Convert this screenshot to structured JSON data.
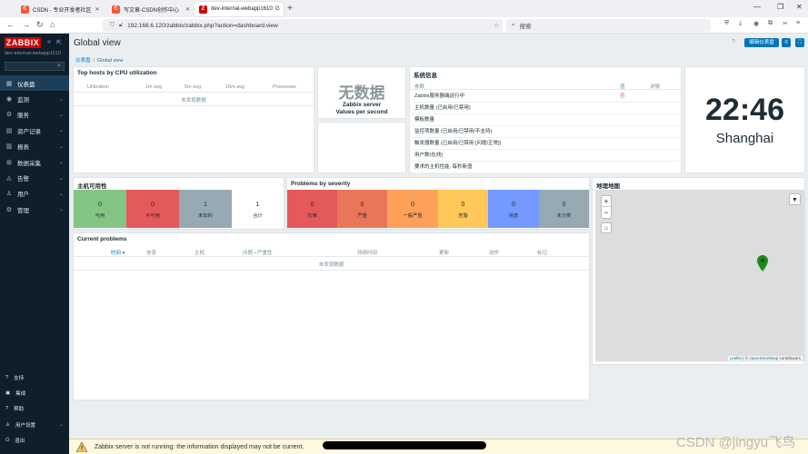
{
  "browser": {
    "tabs": [
      {
        "label": "CSDN - 专业开发者社区",
        "favicon": "C",
        "color": "#fc5531"
      },
      {
        "label": "写文章-CSDN创作中心",
        "favicon": "C",
        "color": "#fc5531"
      },
      {
        "label": "dev-internal-webapp1610: G",
        "favicon": "Z",
        "color": "#d40000"
      }
    ],
    "url": "192.168.6.120/zabbix/zabbix.php?action=dashboard.view",
    "search_placeholder": "搜索"
  },
  "sidebar": {
    "logo": "ZABBIX",
    "hostname": "dev-internal-webapp1610",
    "items": [
      {
        "label": "仪表盘",
        "icon": "dashboard-icon",
        "active": true
      },
      {
        "label": "监测",
        "icon": "eye-icon"
      },
      {
        "label": "服务",
        "icon": "services-icon"
      },
      {
        "label": "资产记录",
        "icon": "inventory-icon"
      },
      {
        "label": "报表",
        "icon": "reports-icon"
      },
      {
        "label": "数据采集",
        "icon": "data-collection-icon"
      },
      {
        "label": "告警",
        "icon": "bell-icon"
      },
      {
        "label": "用户",
        "icon": "users-icon"
      },
      {
        "label": "管理",
        "icon": "gear-icon"
      }
    ],
    "bottom_items": [
      {
        "label": "支持",
        "icon": "support-icon"
      },
      {
        "label": "集成",
        "icon": "integrations-icon"
      },
      {
        "label": "帮助",
        "icon": "help-icon"
      },
      {
        "label": "用户设置",
        "icon": "user-settings-icon"
      },
      {
        "label": "退出",
        "icon": "sign-out-icon"
      }
    ]
  },
  "header": {
    "title": "Global view",
    "edit_label": "编辑仪表盘",
    "breadcrumb": [
      "仪表盘",
      "Global view"
    ]
  },
  "top_hosts": {
    "title": "Top hosts by CPU utilization",
    "columns": [
      "Utilization",
      "1m avg",
      "5m avg",
      "15m avg",
      "Processes"
    ],
    "no_data": "未发现数据"
  },
  "server_values": {
    "big": "无数据",
    "line1": "Zabbix server",
    "line2": "Values per second"
  },
  "system_info": {
    "title": "系统信息",
    "columns": [
      "参数",
      "值",
      "详情"
    ],
    "rows": [
      {
        "param": "Zabbix服务器端运行中",
        "value": "否",
        "detail": ""
      },
      {
        "param": "主机数量 (已启用/已禁用)",
        "value": "",
        "detail": ""
      },
      {
        "param": "模板数量",
        "value": "",
        "detail": ""
      },
      {
        "param": "监控项数量 (已启用/已禁用/不支持)",
        "value": "",
        "detail": ""
      },
      {
        "param": "触发器数量 (已启用/已禁用 [问题/正常])",
        "value": "",
        "detail": ""
      },
      {
        "param": "用户数(在线)",
        "value": "",
        "detail": ""
      },
      {
        "param": "要求的主机性能, 每秒新值",
        "value": "",
        "detail": ""
      }
    ]
  },
  "clock": {
    "time": "22:46",
    "timezone": "Shanghai"
  },
  "host_availability": {
    "title": "主机可用性",
    "cells": [
      {
        "count": "0",
        "label": "可用",
        "color": "#84c584"
      },
      {
        "count": "0",
        "label": "不可用",
        "color": "#e45959"
      },
      {
        "count": "1",
        "label": "未知的",
        "color": "#97aab3"
      },
      {
        "count": "1",
        "label": "合计",
        "color": "#ffffff"
      }
    ]
  },
  "problems_by_severity": {
    "title": "Problems by severity",
    "cells": [
      {
        "count": "0",
        "label": "灾难",
        "color": "#e45959"
      },
      {
        "count": "0",
        "label": "严重",
        "color": "#e97659"
      },
      {
        "count": "0",
        "label": "一般严重",
        "color": "#ffa059"
      },
      {
        "count": "0",
        "label": "告警",
        "color": "#ffc859"
      },
      {
        "count": "0",
        "label": "信息",
        "color": "#7499ff"
      },
      {
        "count": "0",
        "label": "未分类",
        "color": "#97aab3"
      }
    ]
  },
  "current_problems": {
    "title": "Current problems",
    "columns": [
      "时间 ▾",
      "信息",
      "主机",
      "问题 • 严重性",
      "持续时间",
      "更新",
      "动作",
      "标记"
    ],
    "no_data": "未发现数据"
  },
  "geomap": {
    "title": "地理地图",
    "attribution_leaflet": "Leaflet",
    "attribution_sep": "| ©",
    "attribution_osm": "OpenStreetMap",
    "attribution_tail": "contributors"
  },
  "warning": {
    "text": "Zabbix server is not running: the information displayed may not be current."
  },
  "watermark": "CSDN @jingyu飞鸟"
}
